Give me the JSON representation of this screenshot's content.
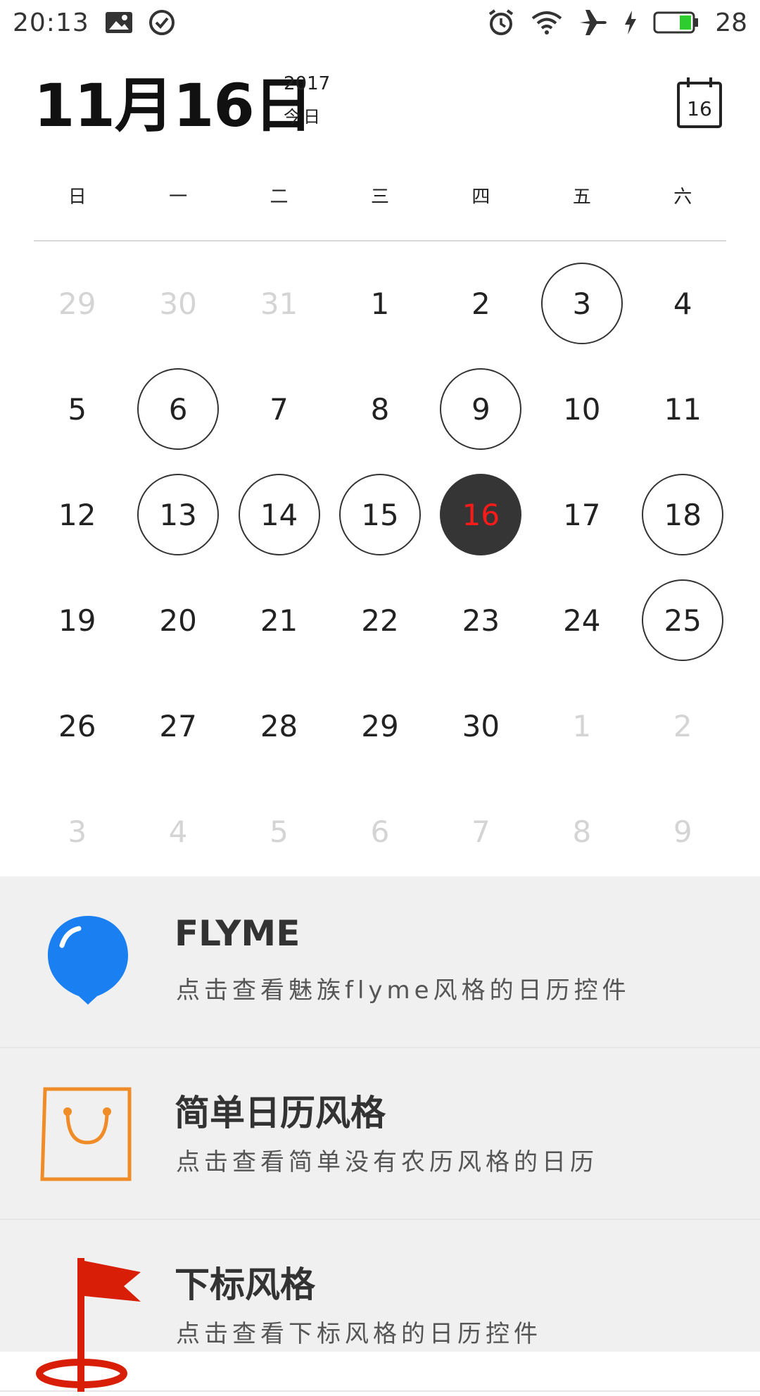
{
  "status_bar": {
    "time": "20:13",
    "battery_percent": "28",
    "battery_color": "#2ecc2e"
  },
  "header": {
    "date": "11月16日",
    "year": "2017",
    "today_label": "今日",
    "calendar_icon_day": "16"
  },
  "week_days": [
    "日",
    "一",
    "二",
    "三",
    "四",
    "五",
    "六"
  ],
  "calendar": {
    "weeks": [
      [
        {
          "d": "29",
          "t": "other"
        },
        {
          "d": "30",
          "t": "other"
        },
        {
          "d": "31",
          "t": "other"
        },
        {
          "d": "1",
          "t": "normal"
        },
        {
          "d": "2",
          "t": "normal"
        },
        {
          "d": "3",
          "t": "circled"
        },
        {
          "d": "4",
          "t": "normal"
        }
      ],
      [
        {
          "d": "5",
          "t": "normal"
        },
        {
          "d": "6",
          "t": "circled"
        },
        {
          "d": "7",
          "t": "normal"
        },
        {
          "d": "8",
          "t": "normal"
        },
        {
          "d": "9",
          "t": "circled"
        },
        {
          "d": "10",
          "t": "normal"
        },
        {
          "d": "11",
          "t": "normal"
        }
      ],
      [
        {
          "d": "12",
          "t": "normal"
        },
        {
          "d": "13",
          "t": "circled"
        },
        {
          "d": "14",
          "t": "circled"
        },
        {
          "d": "15",
          "t": "circled"
        },
        {
          "d": "16",
          "t": "today"
        },
        {
          "d": "17",
          "t": "normal"
        },
        {
          "d": "18",
          "t": "circled"
        }
      ],
      [
        {
          "d": "19",
          "t": "normal"
        },
        {
          "d": "20",
          "t": "normal"
        },
        {
          "d": "21",
          "t": "normal"
        },
        {
          "d": "22",
          "t": "normal"
        },
        {
          "d": "23",
          "t": "normal"
        },
        {
          "d": "24",
          "t": "normal"
        },
        {
          "d": "25",
          "t": "circled"
        }
      ],
      [
        {
          "d": "26",
          "t": "normal"
        },
        {
          "d": "27",
          "t": "normal"
        },
        {
          "d": "28",
          "t": "normal"
        },
        {
          "d": "29",
          "t": "normal"
        },
        {
          "d": "30",
          "t": "normal"
        },
        {
          "d": "1",
          "t": "other"
        },
        {
          "d": "2",
          "t": "other"
        }
      ],
      [
        {
          "d": "3",
          "t": "other"
        },
        {
          "d": "4",
          "t": "other"
        },
        {
          "d": "5",
          "t": "other"
        },
        {
          "d": "6",
          "t": "other"
        },
        {
          "d": "7",
          "t": "other"
        },
        {
          "d": "8",
          "t": "other"
        },
        {
          "d": "9",
          "t": "other"
        }
      ]
    ],
    "today_color": "#ff1a1a"
  },
  "list": [
    {
      "title": "FLYME",
      "subtitle": "点击查看魅族flyme风格的日历控件",
      "icon": "blue-balloon-icon",
      "icon_color": "#1a7ff0"
    },
    {
      "title": "简单日历风格",
      "subtitle": "点击查看简单没有农历风格的日历",
      "icon": "shopping-bag-icon",
      "icon_color": "#f08c28"
    },
    {
      "title": "下标风格",
      "subtitle": "点击查看下标风格的日历控件",
      "icon": "red-flag-icon",
      "icon_color": "#d81e06"
    }
  ]
}
